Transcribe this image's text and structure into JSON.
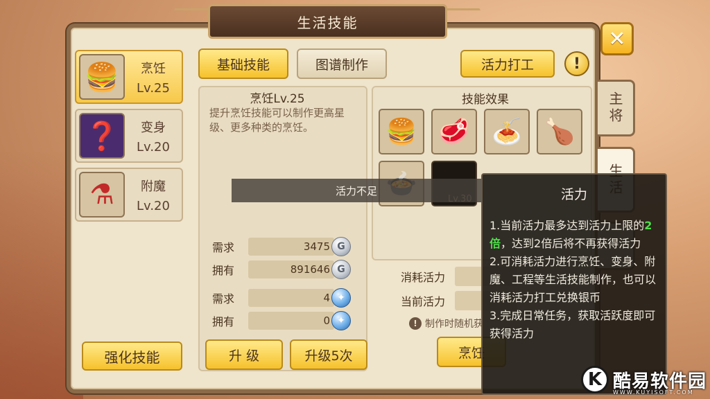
{
  "window": {
    "title": "生活技能"
  },
  "close_label": "✕",
  "side_tabs": [
    {
      "label": "主将"
    },
    {
      "label": "生活"
    },
    {
      "label": ""
    }
  ],
  "skills": [
    {
      "name": "烹饪",
      "level": "Lv.25",
      "icon": "burger-icon",
      "glyph": "🍔"
    },
    {
      "name": "变身",
      "level": "Lv.20",
      "icon": "mystery-card-icon",
      "glyph": "❓"
    },
    {
      "name": "附魔",
      "level": "Lv.20",
      "icon": "potion-icon",
      "glyph": "⚗"
    }
  ],
  "strengthen_label": "强化技能",
  "tabs": [
    {
      "label": "基础技能",
      "active": true
    },
    {
      "label": "图谱制作",
      "active": false
    }
  ],
  "work_label": "活力打工",
  "info_label": "!",
  "center": {
    "title": "烹饪Lv.25",
    "description": "提升烹饪技能可以制作更高星级、更多种类的烹饪。",
    "resources": [
      {
        "label": "需求",
        "value": "3475",
        "coin": "silver",
        "coin_glyph": "G"
      },
      {
        "label": "拥有",
        "value": "891646",
        "coin": "silver",
        "coin_glyph": "G"
      },
      {
        "label": "需求",
        "value": "4",
        "coin": "blue",
        "coin_glyph": "✦"
      },
      {
        "label": "拥有",
        "value": "0",
        "coin": "blue",
        "coin_glyph": "✦"
      }
    ],
    "upgrade_label": "升 级",
    "upgrade5_label": "升级5次"
  },
  "effects": {
    "title": "技能效果",
    "foods": [
      {
        "icon": "burger-icon",
        "glyph": "🍔"
      },
      {
        "icon": "steak-plate-icon",
        "glyph": "🥩"
      },
      {
        "icon": "pasta-plate-icon",
        "glyph": "🍝"
      },
      {
        "icon": "roast-chicken-icon",
        "glyph": "🍗"
      },
      {
        "icon": "stew-bowl-icon",
        "glyph": "🍲"
      },
      {
        "icon": "locked-dish-icon",
        "glyph": ""
      }
    ],
    "locked_level": "Lv.30"
  },
  "stats": [
    {
      "label": "消耗活力"
    },
    {
      "label": "当前活力"
    }
  ],
  "note_text": "制作时随机获",
  "cook_label": "烹饪",
  "toast": "活力不足",
  "tooltip": {
    "title": "活力",
    "line1_pre": "1.当前活力最多达到活力上限的",
    "line1_hl": "2倍",
    "line1_post": "，达到2倍后将不再获得活力",
    "line2": "2.可消耗活力进行烹饪、变身、附魔、工程等生活技能制作，也可以消耗活力打工兑换银币",
    "line3": "3.完成日常任务，获取活跃度即可获得活力"
  },
  "watermark": {
    "logo": "K",
    "text": "酷易软件园",
    "sub": "WWW.KUYISOFT.COM"
  }
}
